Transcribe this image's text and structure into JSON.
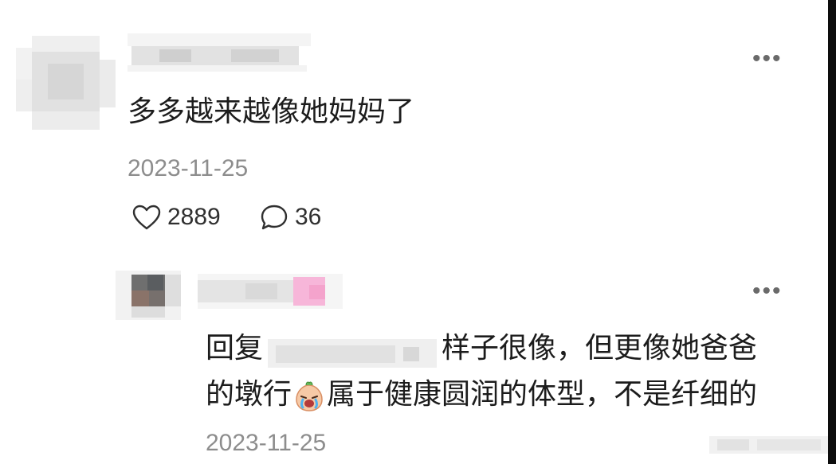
{
  "comment": {
    "text": "多多越来越像她妈妈了",
    "date": "2023-11-25",
    "likes": "2889",
    "replies": "36",
    "more_icon": "ellipsis-icon",
    "like_icon": "heart-outline-icon",
    "reply_icon": "speech-bubble-icon"
  },
  "reply": {
    "prefix": "回复",
    "text_line1": "样子很像，但更像她爸爸",
    "text_line2_a": "的墩行",
    "emoji": "crying-face-emoji",
    "text_line2_b": "属于健康圆润的体型，不是纤细的",
    "date": "2023-11-25",
    "more_icon": "ellipsis-icon"
  },
  "colors": {
    "text": "#1c1c1c",
    "secondary": "#8d8d8d",
    "icon": "#303030",
    "blur": "#e6e6e6",
    "accent_pink": "#f7b6d9"
  }
}
